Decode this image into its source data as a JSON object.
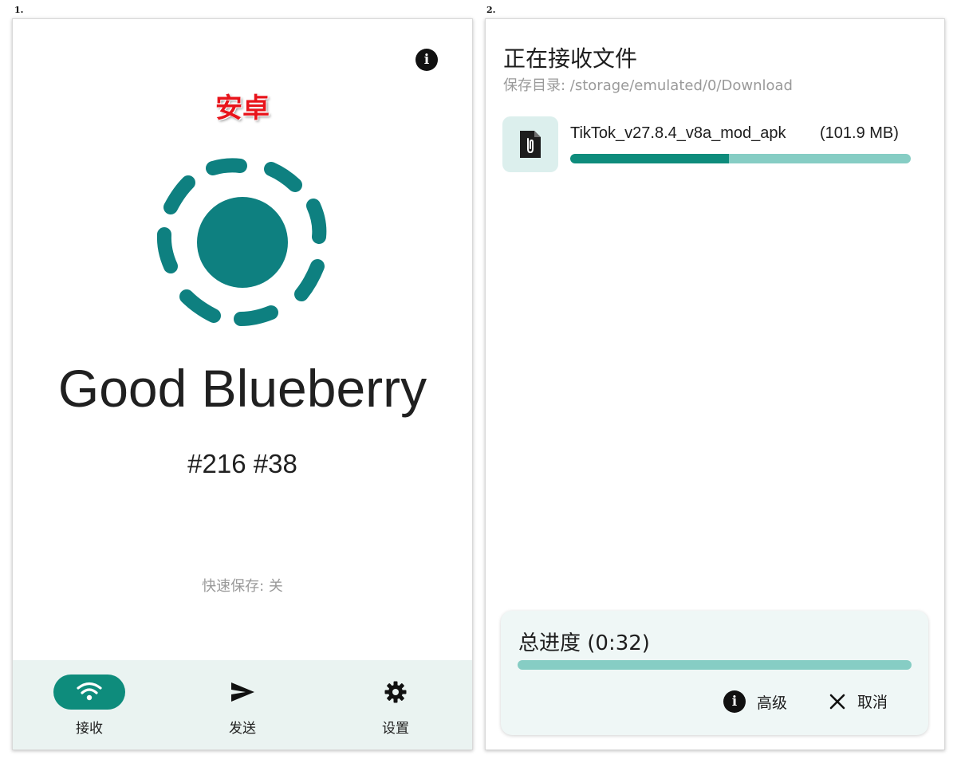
{
  "panels": [
    {
      "number": "1.",
      "platform_label": "安卓",
      "device_name": "Good Blueberry",
      "device_id": "#216 #38",
      "quick_save": "快速保存: 关",
      "info_icon": "info-icon",
      "nav": [
        {
          "label": "接收",
          "icon": "wifi-icon",
          "active": true
        },
        {
          "label": "发送",
          "icon": "send-icon",
          "active": false
        },
        {
          "label": "设置",
          "icon": "gear-icon",
          "active": false
        }
      ]
    },
    {
      "number": "2.",
      "title": "正在接收文件",
      "save_dir": "保存目录: /storage/emulated/0/Download",
      "file": {
        "name": "TikTok_v27.8.4_v8a_mod_apk",
        "size": "(101.9 MB)",
        "icon": "file-attachment-icon",
        "progress": 0.465
      },
      "total": {
        "label": "总进度 (0:32)",
        "progress": 0
      },
      "actions": {
        "advanced": "高级",
        "cancel": "取消"
      }
    }
  ],
  "colors": {
    "accent": "#0e8c7c",
    "accent_light": "#86cdc4",
    "nav_bg": "#eaf3f1",
    "platform_label": "#e8141b"
  }
}
